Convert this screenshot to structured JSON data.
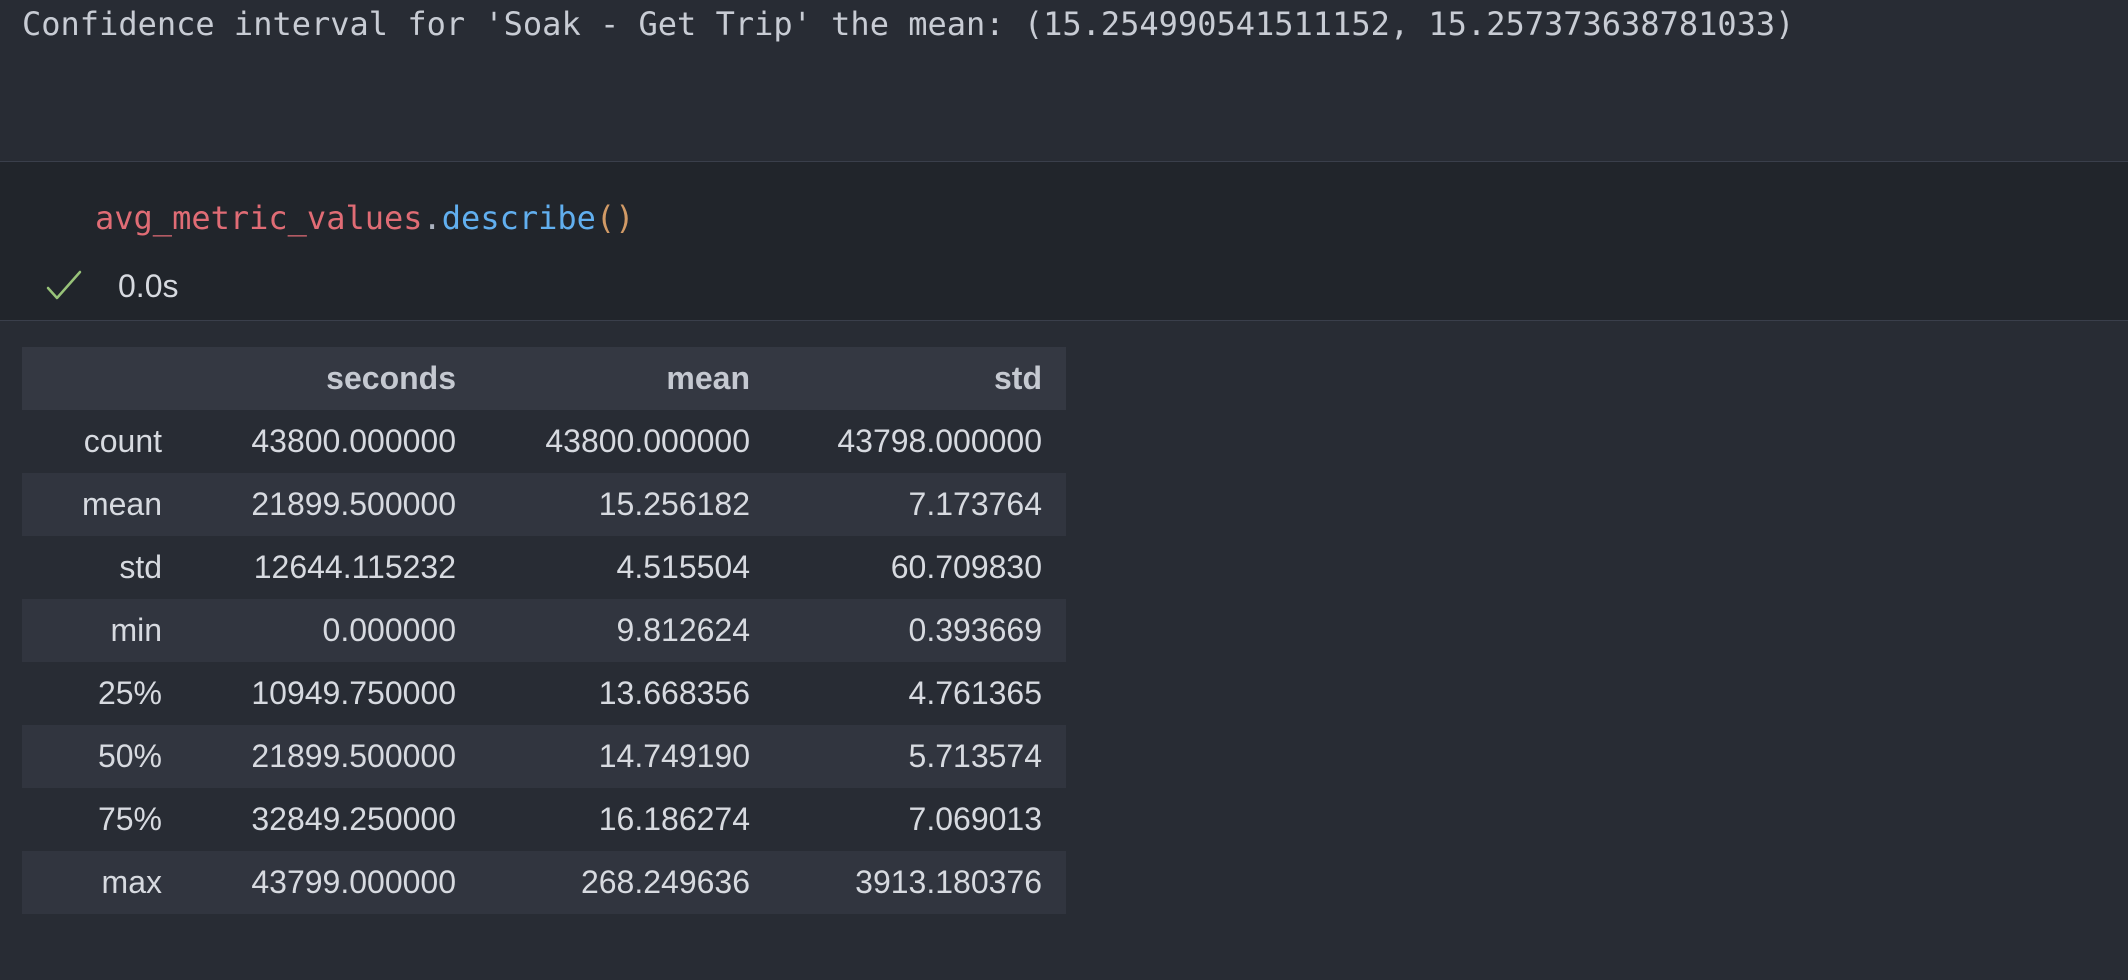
{
  "previous_output": {
    "text": "Confidence interval for 'Soak - Get Trip' the mean: (15.254990541511152, 15.257373638781033)"
  },
  "cell": {
    "code": {
      "variable": "avg_metric_values",
      "dot": ".",
      "method": "describe",
      "parens": "()"
    },
    "status": {
      "icon": "check-icon",
      "exec_time": "0.0s",
      "color": "#98c379"
    }
  },
  "dataframe": {
    "columns": [
      "",
      "seconds",
      "mean",
      "std"
    ],
    "rows": [
      {
        "index": "count",
        "values": [
          "43800.000000",
          "43800.000000",
          "43798.000000"
        ]
      },
      {
        "index": "mean",
        "values": [
          "21899.500000",
          "15.256182",
          "7.173764"
        ]
      },
      {
        "index": "std",
        "values": [
          "12644.115232",
          "4.515504",
          "60.709830"
        ]
      },
      {
        "index": "min",
        "values": [
          "0.000000",
          "9.812624",
          "0.393669"
        ]
      },
      {
        "index": "25%",
        "values": [
          "10949.750000",
          "13.668356",
          "4.761365"
        ]
      },
      {
        "index": "50%",
        "values": [
          "21899.500000",
          "14.749190",
          "5.713574"
        ]
      },
      {
        "index": "75%",
        "values": [
          "32849.250000",
          "16.186274",
          "7.069013"
        ]
      },
      {
        "index": "max",
        "values": [
          "43799.000000",
          "268.249636",
          "3913.180376"
        ]
      }
    ]
  }
}
